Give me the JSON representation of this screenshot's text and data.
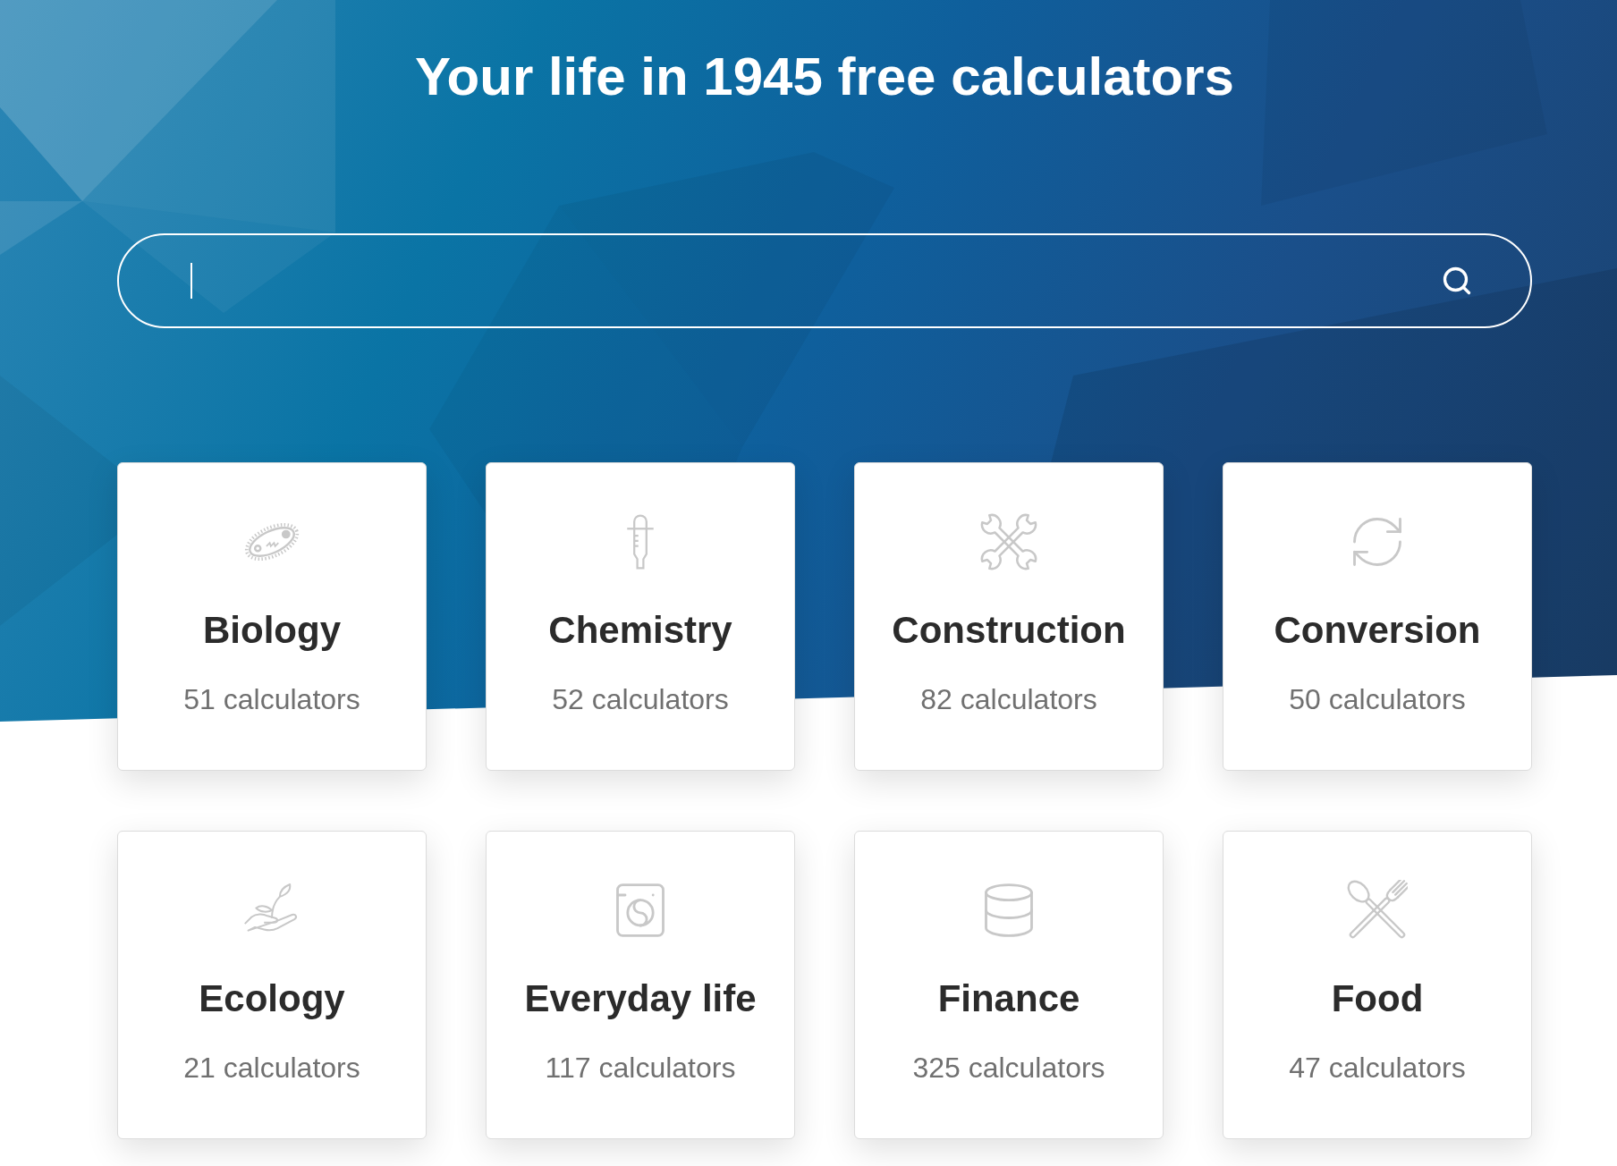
{
  "heading": "Your life in 1945 free calculators",
  "search": {
    "focused": true
  },
  "categories": [
    {
      "name": "Biology",
      "count": "51 calculators"
    },
    {
      "name": "Chemistry",
      "count": "52 calculators"
    },
    {
      "name": "Construction",
      "count": "82 calculators"
    },
    {
      "name": "Conversion",
      "count": "50 calculators"
    },
    {
      "name": "Ecology",
      "count": "21 calculators"
    },
    {
      "name": "Everyday life",
      "count": "117 calculators"
    },
    {
      "name": "Finance",
      "count": "325 calculators"
    },
    {
      "name": "Food",
      "count": "47 calculators"
    }
  ]
}
